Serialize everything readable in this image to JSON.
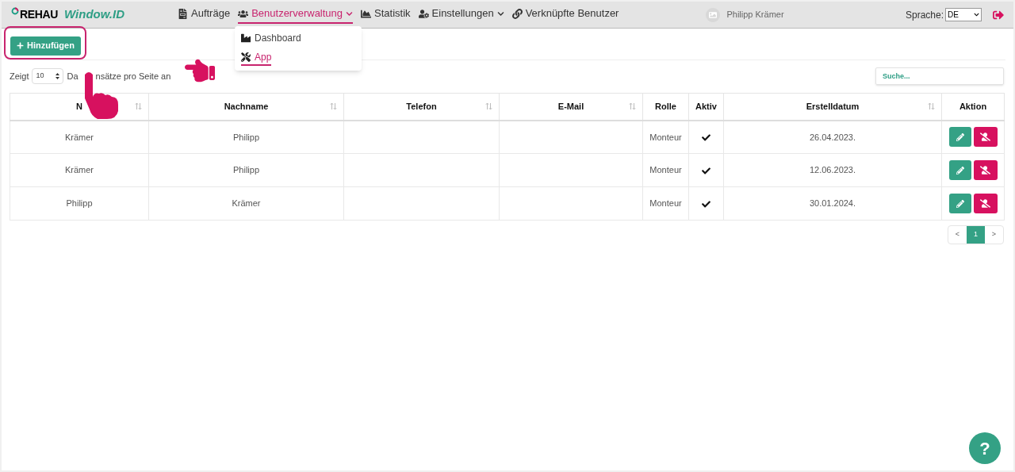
{
  "brand": {
    "mark": "REHAU",
    "product": "Window.ID"
  },
  "nav": [
    {
      "label": "Aufträge",
      "selected": false,
      "dropdown": false
    },
    {
      "label": "Benutzerverwaltung",
      "selected": true,
      "dropdown": true
    },
    {
      "label": "Statistik",
      "selected": false,
      "dropdown": false
    },
    {
      "label": "Einstellungen",
      "selected": false,
      "dropdown": true
    },
    {
      "label": "Verknüpfte Benutzer",
      "selected": false,
      "dropdown": false
    }
  ],
  "user": {
    "name": "Philipp Krämer"
  },
  "language": {
    "label": "Sprache:",
    "value": "DE"
  },
  "dropdown_menu": [
    {
      "label": "Dashboard",
      "selected": false
    },
    {
      "label": "App",
      "selected": true
    }
  ],
  "add_button": "Hinzufügen",
  "page_length": {
    "before": "Zeigt",
    "value": "10",
    "after_part_1": "Da",
    "after_part_2": "nsätze pro Seite an"
  },
  "search": {
    "placeholder": "Suche..."
  },
  "table": {
    "columns": [
      {
        "label": "N",
        "sortable": true
      },
      {
        "label": "Nachname",
        "sortable": true
      },
      {
        "label": "Telefon",
        "sortable": true
      },
      {
        "label": "E-Mail",
        "sortable": true
      },
      {
        "label": "Rolle",
        "sortable": false
      },
      {
        "label": "Aktiv",
        "sortable": false
      },
      {
        "label": "Erstelldatum",
        "sortable": true
      },
      {
        "label": "Aktion",
        "sortable": false
      }
    ],
    "rows": [
      {
        "cells": [
          "Krämer",
          "Philipp",
          "",
          "",
          "Monteur"
        ],
        "active": true,
        "date": "26.04.2023."
      },
      {
        "cells": [
          "Krämer",
          "Philipp",
          "",
          "",
          "Monteur"
        ],
        "active": true,
        "date": "12.06.2023."
      },
      {
        "cells": [
          "Philipp",
          "Krämer",
          "",
          "",
          "Monteur"
        ],
        "active": true,
        "date": "30.01.2024."
      }
    ]
  },
  "pagination": {
    "prev": "<",
    "pages": [
      {
        "label": "1",
        "selected": true
      }
    ],
    "next": ">"
  },
  "help_button": "?"
}
